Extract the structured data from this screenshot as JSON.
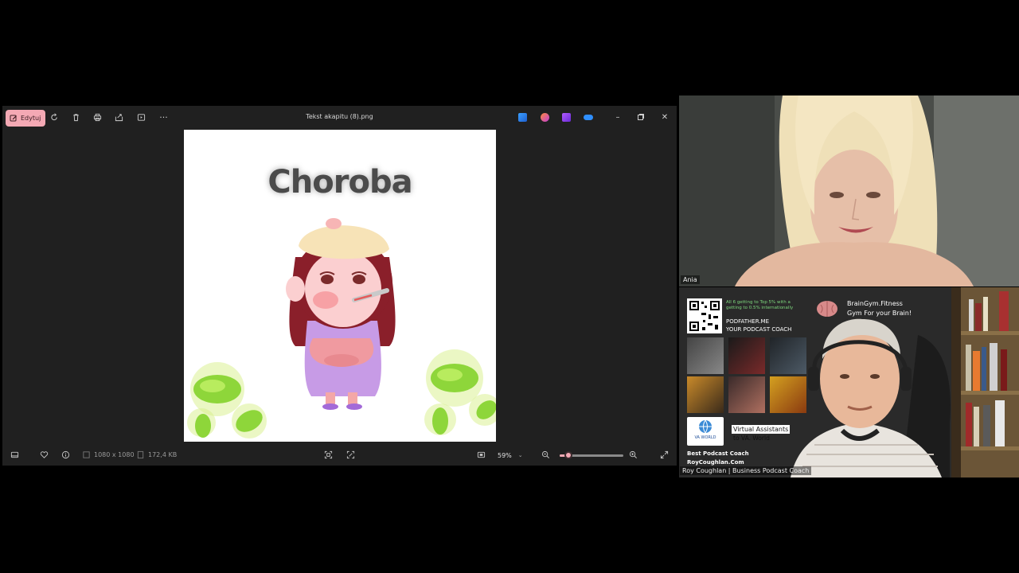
{
  "viewer": {
    "edit_label": "Edytuj",
    "file_name": "Tekst akapitu (8).png",
    "image_text": "Choroba",
    "dimensions": "1080 x 1080",
    "file_size": "172,4 KB",
    "zoom": "59%",
    "zoom_level": 0.14,
    "accent": "#f4a9b4"
  },
  "participants": {
    "ania": {
      "name": "Ania"
    },
    "roy": {
      "name": "Roy Coughlan | Business Podcast Coach"
    }
  },
  "banner": {
    "promo_line": "All 6 getting to Top 5% with a getting to 0.5% internationally",
    "podfather_1": "PODFATHER.ME",
    "podfather_2": "YOUR PODCAST COACH",
    "braingym_1": "BrainGym.Fitness",
    "braingym_2": "Gym For your Brain!",
    "va_1": "Virtual Assistants",
    "va_2": "to VA. World",
    "va_logo": "VA WORLD",
    "best_1": "Best Podcast Coach",
    "best_2": "RoyCoughlan.Com"
  }
}
